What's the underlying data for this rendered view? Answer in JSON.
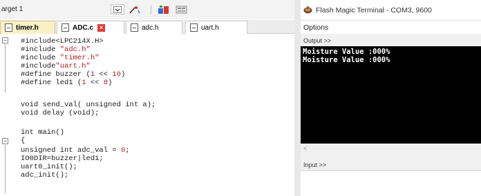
{
  "ide": {
    "target_label": "arget 1",
    "tabs": [
      {
        "label": "timer.h",
        "active": true
      },
      {
        "label": "ADC.c",
        "active": false,
        "closable": true
      },
      {
        "label": "adc.h",
        "active": false
      },
      {
        "label": "uart.h",
        "active": false
      }
    ],
    "code": {
      "l1_pre": "#include<LPC214X.H>",
      "l2_pre": "#include ",
      "l2_str": "\"adc.h\"",
      "l3_pre": "#include ",
      "l3_str": "\"timer.h\"",
      "l4_pre": "#include",
      "l4_str": "\"uart.h\"",
      "l5_pre": "#define buzzer (",
      "l5_num": "1",
      "l5_mid": " << ",
      "l5_num2": "10",
      "l5_end": ")",
      "l6_pre": "#define led1 (",
      "l6_num": "1",
      "l6_mid": " << ",
      "l6_num2": "8",
      "l6_end": ")",
      "l7": "void send_val( unsigned int a);",
      "l8": "void delay (void);",
      "l9": "int main()",
      "l10": "{",
      "l11_pre": "unsigned int adc_val = ",
      "l11_num": "0",
      "l11_end": ";",
      "l12": "IO0DIR=buzzer|led1;",
      "l13": "uart0_init();",
      "l14": "adc_init();"
    }
  },
  "terminal": {
    "title": "Flash Magic Terminal - COM3, 9600",
    "menu_options": "Options",
    "output_label": "Output >>",
    "output_lines": [
      "Moisture Value :000%",
      "Moisture Value :000%"
    ],
    "input_label": "Input >>",
    "scroll_left_arrow": "<",
    "icons": {
      "app": "flash-magic-icon"
    }
  }
}
